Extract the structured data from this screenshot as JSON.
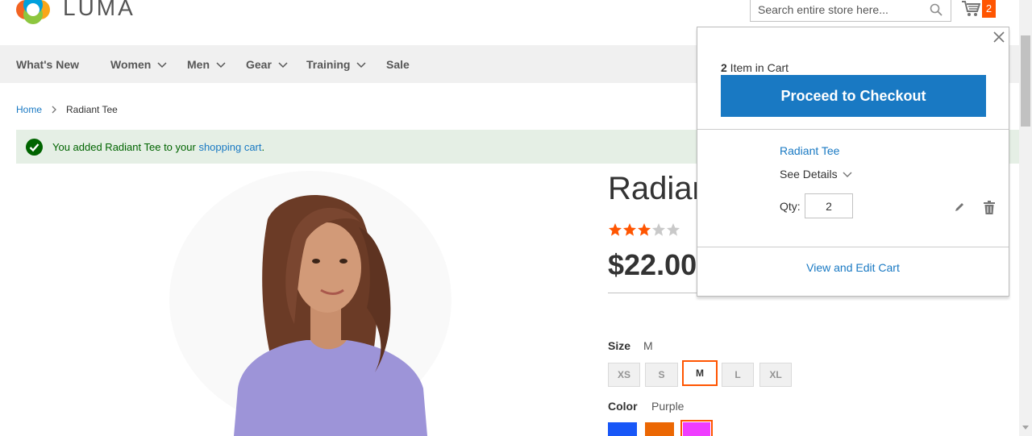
{
  "header": {
    "logo_text": "LUMA",
    "search_placeholder": "Search entire store here...",
    "cart_count": "2"
  },
  "nav": {
    "items": [
      {
        "label": "What's New",
        "has_dropdown": false
      },
      {
        "label": "Women",
        "has_dropdown": true
      },
      {
        "label": "Men",
        "has_dropdown": true
      },
      {
        "label": "Gear",
        "has_dropdown": true
      },
      {
        "label": "Training",
        "has_dropdown": true
      },
      {
        "label": "Sale",
        "has_dropdown": false
      }
    ]
  },
  "breadcrumb": {
    "home": "Home",
    "current": "Radiant Tee"
  },
  "message": {
    "prefix": "You added Radiant Tee to your ",
    "link": "shopping cart",
    "suffix": "."
  },
  "product": {
    "title": "Radiant Tee",
    "rating_fraction": 0.6,
    "price": "$22.00",
    "size_label": "Size",
    "size_selected": "M",
    "sizes": [
      "XS",
      "S",
      "M",
      "L",
      "XL"
    ],
    "color_label": "Color",
    "color_selected": "Purple",
    "colors": [
      "#1857f7",
      "#eb6703",
      "#ef3dff"
    ]
  },
  "minicart": {
    "count": "2",
    "count_suffix": " Item in Cart",
    "checkout_label": "Proceed to Checkout",
    "item_name": "Radiant Tee",
    "see_details": "See Details",
    "qty_label": "Qty:",
    "qty_value": "2",
    "view_edit_label": "View and Edit Cart"
  },
  "colors": {
    "accent": "#1979c3",
    "badge": "#ff5501",
    "star": "#ff5501",
    "success_bg": "#e5efe5",
    "success_text": "#006400"
  }
}
